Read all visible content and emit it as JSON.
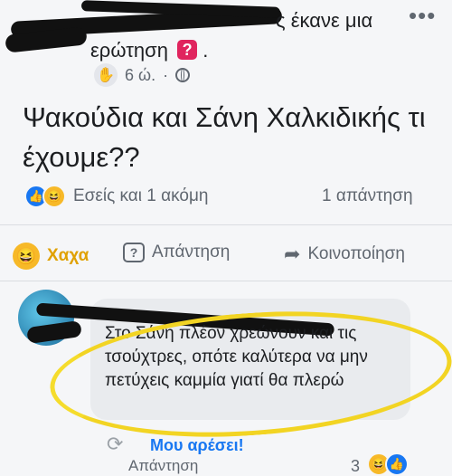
{
  "header": {
    "author_suffix": "ς έκανε μια",
    "line2": "ερώτηση",
    "question_badge": "?",
    "dot_after": ".",
    "more_label": "•••"
  },
  "meta": {
    "time": "6 ώ.",
    "sep": "·",
    "hand_icon": "✋"
  },
  "post": {
    "text": "Ψακούδια και Σάνη Χαλκιδικής τι έχουμε??"
  },
  "reactions": {
    "like_icon": "👍",
    "haha_icon": "😆",
    "summary": "Εσείς και 1 ακόμη",
    "reply_count": "1 απάντηση"
  },
  "actions": {
    "haha_label": "Χαχα",
    "answer_label": "Απάντηση",
    "share_label": "Κοινοποίηση",
    "answer_icon": "?",
    "share_icon": "➦"
  },
  "comment": {
    "text": "Στο Σάνη πλέον χρεώνουν και τις τσούχτρες, οπότε καλύτερα να μην πετύχεις καμμία γιατί θα πλερώ",
    "like_link": "Μου αρέσει!",
    "answer_link": "Απάντηση",
    "count": "3",
    "loop_icon": "⟳"
  },
  "colors": {
    "brand_blue": "#1877f2",
    "highlight_yellow": "#f2d423",
    "haha_yellow": "#f7b928"
  }
}
